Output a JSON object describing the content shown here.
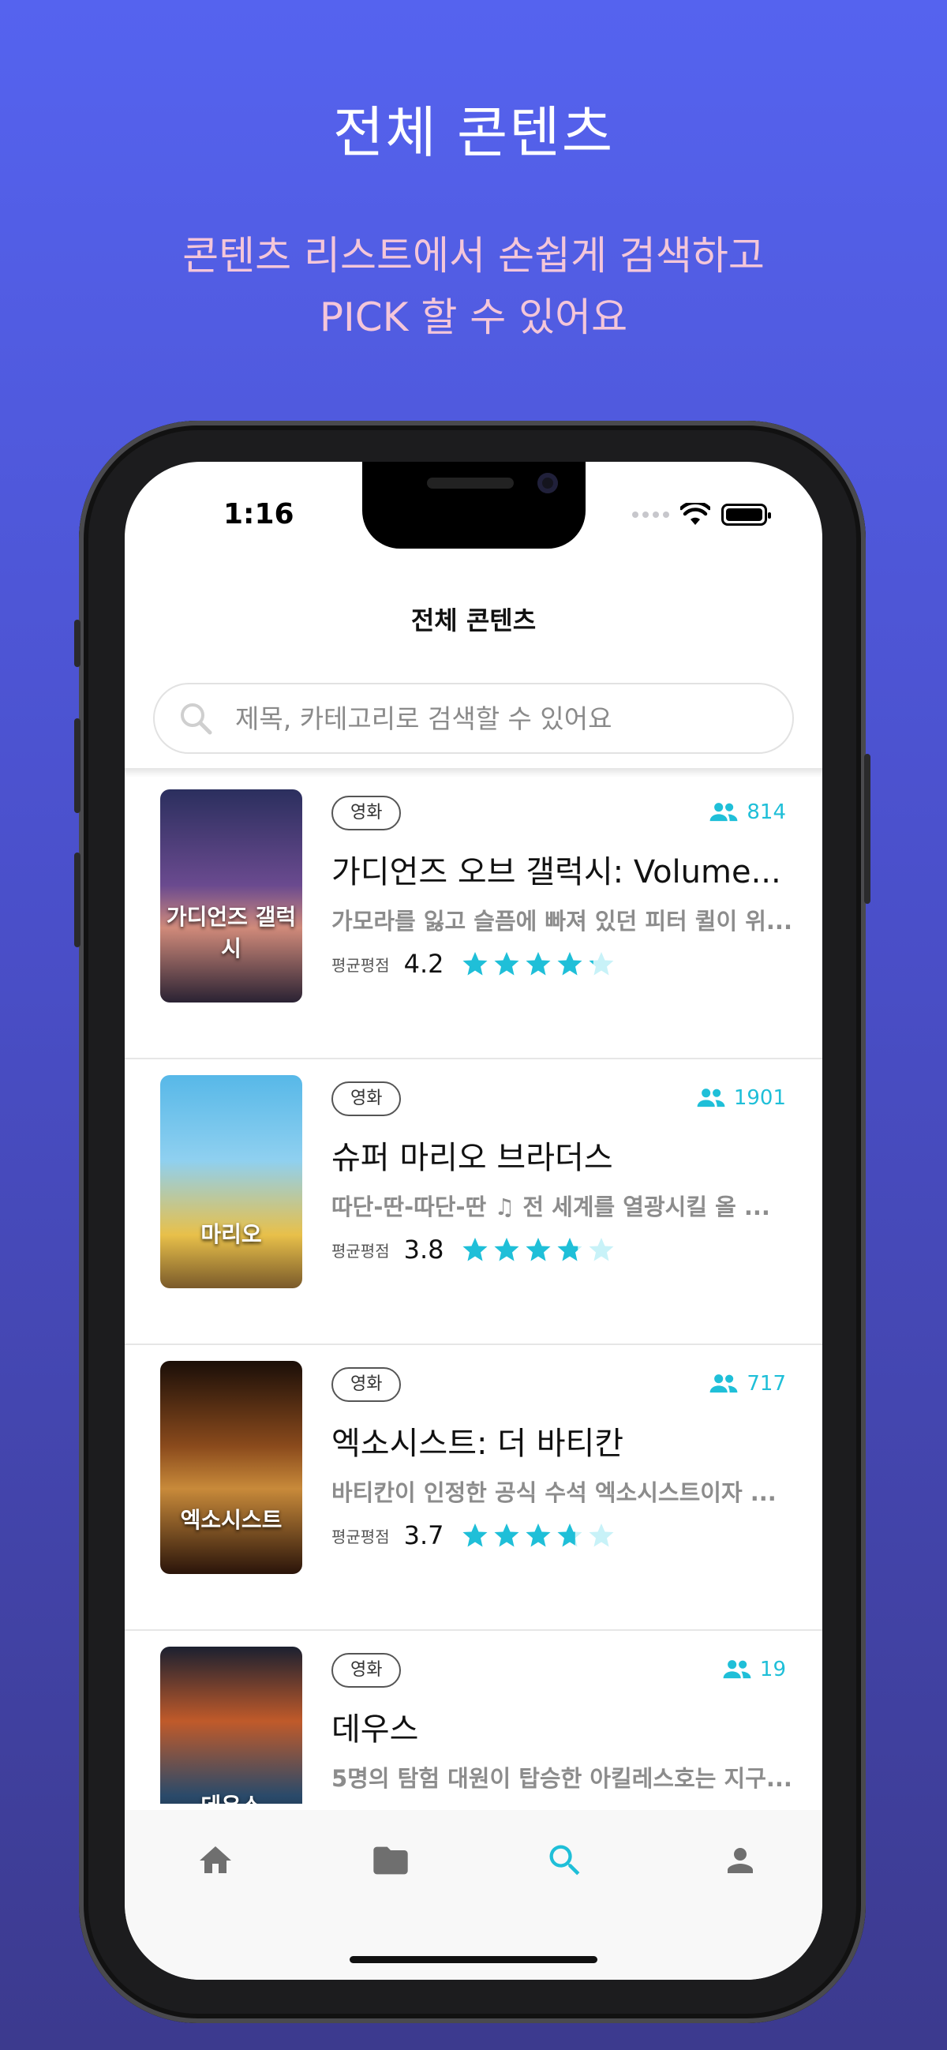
{
  "promo": {
    "headline": "전체 콘텐츠",
    "subline_1": "콘텐츠 리스트에서 손쉽게 검색하고",
    "subline_2": "PICK 할 수 있어요"
  },
  "status_bar": {
    "time": "1:16"
  },
  "app": {
    "title": "전체 콘텐츠",
    "search_placeholder": "제목, 카테고리로 검색할 수 있어요"
  },
  "colors": {
    "accent": "#1fbfd8",
    "background_top": "#5563ef",
    "background_bottom": "#3c3a8e",
    "subline": "#f4c6d9"
  },
  "rating_label": "평균평점",
  "contents": [
    {
      "category": "영화",
      "count": "814",
      "title": "가디언즈 오브 갤럭시: Volume...",
      "description": "가모라를 잃고 슬픔에 빠져 있던 피터 퀼이 위...",
      "rating": "4.2",
      "rating_value": 4.2,
      "poster_text": "가디언즈 갤럭시"
    },
    {
      "category": "영화",
      "count": "1901",
      "title": "슈퍼 마리오 브라더스",
      "description": "따단-딴-따단-딴 ♫ 전 세계를 열광시킬 올 ...",
      "rating": "3.8",
      "rating_value": 3.8,
      "poster_text": "마리오"
    },
    {
      "category": "영화",
      "count": "717",
      "title": "엑소시스트: 더 바티칸",
      "description": "바티칸이 인정한 공식 수석 엑소시스트이자 ...",
      "rating": "3.7",
      "rating_value": 3.7,
      "poster_text": "엑소시스트"
    },
    {
      "category": "영화",
      "count": "19",
      "title": "데우스",
      "description": "5명의 탐험 대원이 탑승한 아킬레스호는 지구...",
      "rating": "",
      "rating_value": null,
      "poster_text": "데우스"
    }
  ],
  "tabbar": {
    "items": [
      {
        "icon": "home-icon",
        "active": false
      },
      {
        "icon": "folder-icon",
        "active": false
      },
      {
        "icon": "search-icon",
        "active": true
      },
      {
        "icon": "person-icon",
        "active": false
      }
    ]
  }
}
